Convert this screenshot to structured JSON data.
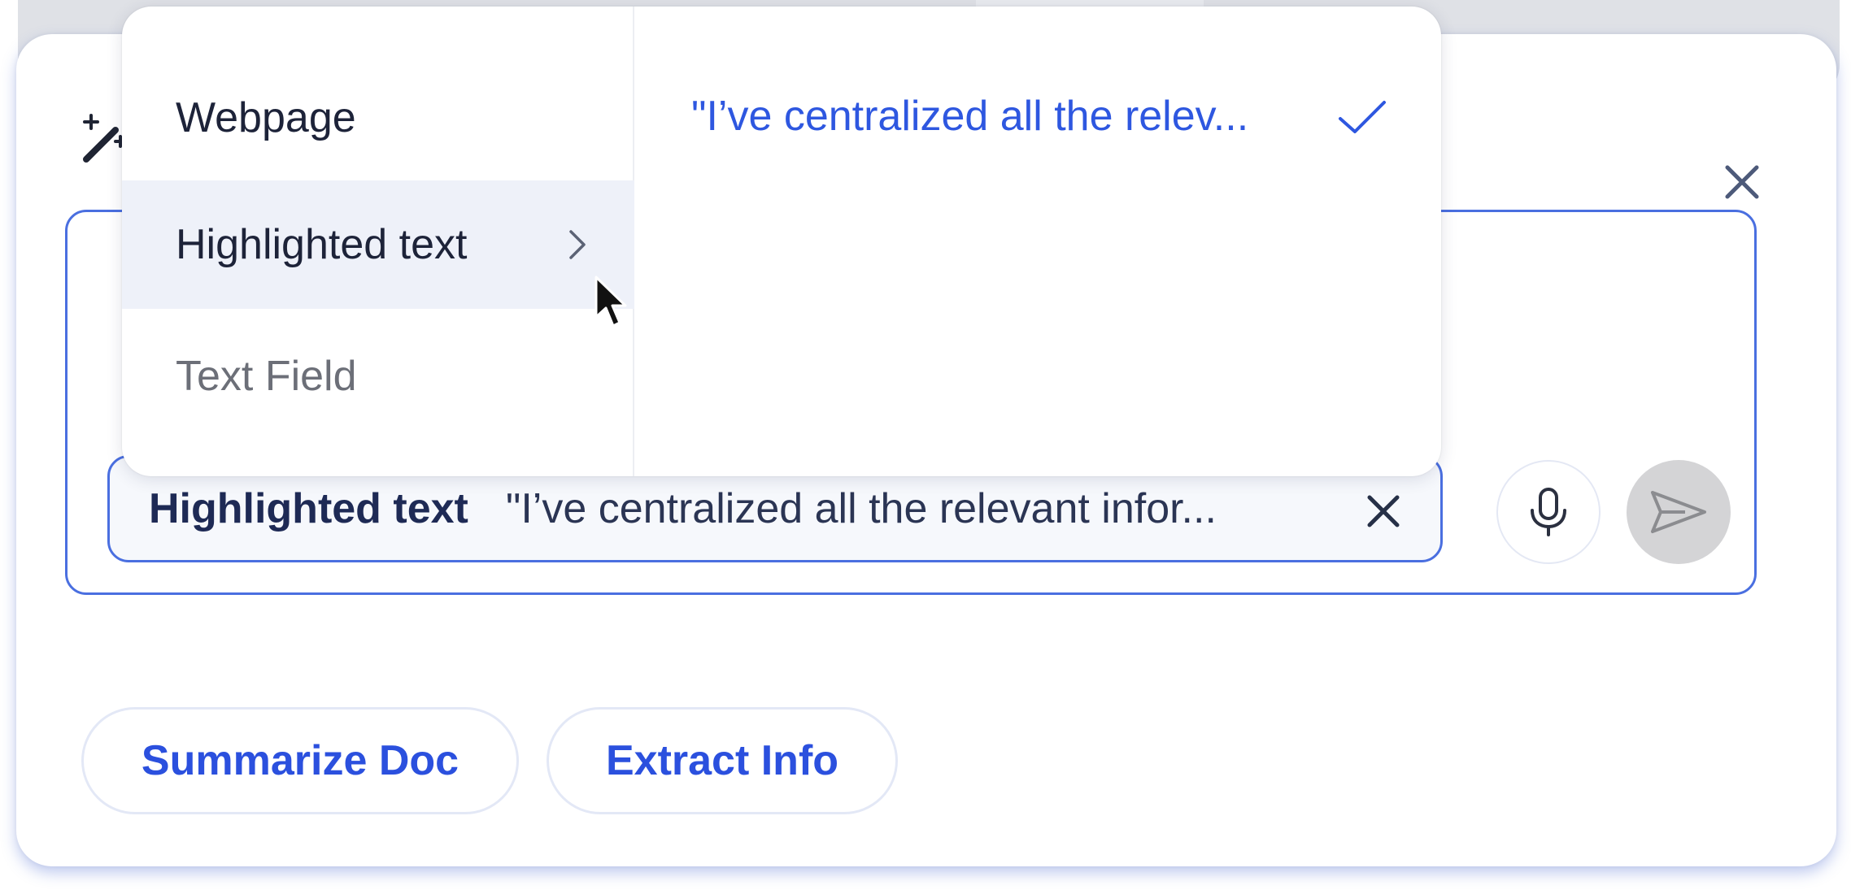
{
  "composer": {
    "context_chip": {
      "label": "Highlighted text",
      "value": "\"I’ve centralized all the relevant infor..."
    }
  },
  "suggestions": [
    {
      "label": "Summarize Doc"
    },
    {
      "label": "Extract Info"
    }
  ],
  "context_menu": {
    "items": [
      {
        "label": "Webpage"
      },
      {
        "label": "Highlighted text"
      },
      {
        "label": "Text Field"
      }
    ],
    "submenu_items": [
      {
        "label": "\"I’ve centralized all the relev..."
      }
    ]
  },
  "icons": {
    "sparkle": "magic-wand-icon",
    "close": "close-icon",
    "chip_clear": "close-icon",
    "mic": "microphone-icon",
    "send": "send-icon",
    "chevron": "chevron-right-icon",
    "check": "checkmark-icon"
  },
  "colors": {
    "accent": "#2e57e0",
    "border_accent": "#4a6fe0",
    "send_disabled": "#d4d4d6"
  }
}
